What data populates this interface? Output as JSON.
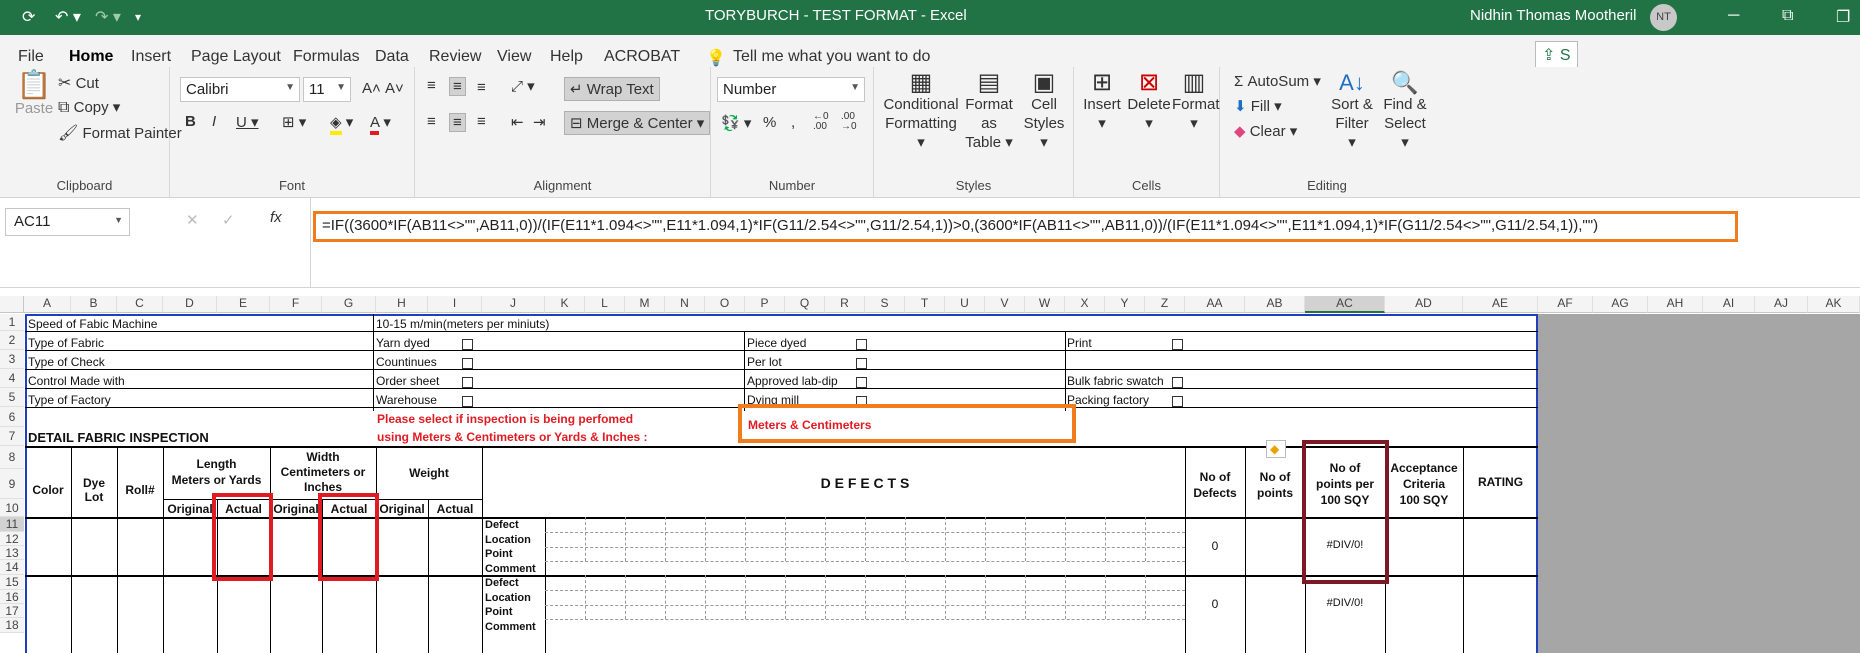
{
  "title_bar": {
    "document": "TORYBURCH - TEST FORMAT  -  Excel",
    "user": "Nidhin Thomas Mootheril",
    "initials": "NT"
  },
  "menu": [
    "File",
    "Home",
    "Insert",
    "Page Layout",
    "Formulas",
    "Data",
    "Review",
    "View",
    "Help",
    "ACROBAT"
  ],
  "tell_me": "Tell me what you want to do",
  "ribbon": {
    "clipboard": {
      "label": "Clipboard",
      "paste": "Paste",
      "cut": "Cut",
      "copy": "Copy",
      "format_painter": "Format Painter"
    },
    "font": {
      "label": "Font",
      "name": "Calibri",
      "size": "11"
    },
    "alignment": {
      "label": "Alignment",
      "wrap": "Wrap Text",
      "merge": "Merge & Center"
    },
    "number": {
      "label": "Number",
      "format": "Number"
    },
    "styles": {
      "label": "Styles",
      "conditional": "Conditional",
      "conditional2": "Formatting",
      "format_as": "Format as",
      "format_as2": "Table",
      "cell": "Cell",
      "cell2": "Styles"
    },
    "cells": {
      "label": "Cells",
      "insert": "Insert",
      "delete": "Delete",
      "format": "Format"
    },
    "editing": {
      "label": "Editing",
      "autosum": "AutoSum",
      "fill": "Fill",
      "clear": "Clear",
      "sort": "Sort &",
      "sort2": "Filter",
      "find": "Find &",
      "find2": "Select"
    }
  },
  "name_box": "AC11",
  "formula": "=IF((3600*IF(AB11<>\"\",AB11,0))/(IF(E11*1.094<>\"\",E11*1.094,1)*IF(G11/2.54<>\"\",G11/2.54,1))>0,(3600*IF(AB11<>\"\",AB11,0))/(IF(E11*1.094<>\"\",E11*1.094,1)*IF(G11/2.54<>\"\",G11/2.54,1)),\"\")",
  "columns": [
    "A",
    "B",
    "C",
    "D",
    "E",
    "F",
    "G",
    "H",
    "I",
    "J",
    "K",
    "L",
    "M",
    "N",
    "O",
    "P",
    "Q",
    "R",
    "S",
    "T",
    "U",
    "V",
    "W",
    "X",
    "Y",
    "Z",
    "AA",
    "AB",
    "AC",
    "AD",
    "AE",
    "AF",
    "AG",
    "AH",
    "AI",
    "AJ",
    "AK"
  ],
  "rows": [
    "1",
    "2",
    "3",
    "4",
    "5",
    "6",
    "7",
    "8",
    "9",
    "10",
    "11",
    "12",
    "13",
    "14",
    "15",
    "16",
    "17",
    "18"
  ],
  "sheet": {
    "r1a": "Speed of Fabic Machine",
    "r1h": "10-15 m/min(meters per miniuts)",
    "r2a": "Type of Fabric",
    "r2h": "Yarn dyed",
    "r2p": "Piece dyed",
    "r2x": "Print",
    "r3a": "Type of Check",
    "r3h": "Countinues",
    "r3p": "Per lot",
    "r4a": "Control Made with",
    "r4h": "Order sheet",
    "r4p": "Approved lab-dip",
    "r4x": "Bulk fabric swatch",
    "r5a": "Type of Factory",
    "r5h": "Warehouse",
    "r5p": "Dying mill",
    "r5x": "Packing factory",
    "detail": "DETAIL FABRIC INSPECTION",
    "please1": "Please select if inspection is being perfomed",
    "please2": "using Meters & Centimeters or Yards & Inches :",
    "units": "Meters & Centimeters",
    "color": "Color",
    "dye1": "Dye",
    "dye2": "Lot",
    "roll": "Roll#",
    "len1": "Length",
    "len2": "Meters or Yards",
    "wid1": "Width",
    "wid2": "Centimeters or",
    "wid3": "Inches",
    "weight": "Weight",
    "original": "Original",
    "actual": "Actual",
    "defects": "D  E  F  E  C  T  S",
    "nodef1": "No of",
    "nodef2": "Defects",
    "nopts1": "No of",
    "nopts2": "points",
    "per1": "No  of",
    "per2": "points per",
    "per3": "100 SQY",
    "acc1": "Acceptance",
    "acc2": "Criteria",
    "acc3": "100 SQY",
    "rating": "RATING",
    "defect": "Defect",
    "location": "Location",
    "point": "Point",
    "comment": "Comment",
    "zero": "0",
    "div": "#DIV/0!"
  }
}
